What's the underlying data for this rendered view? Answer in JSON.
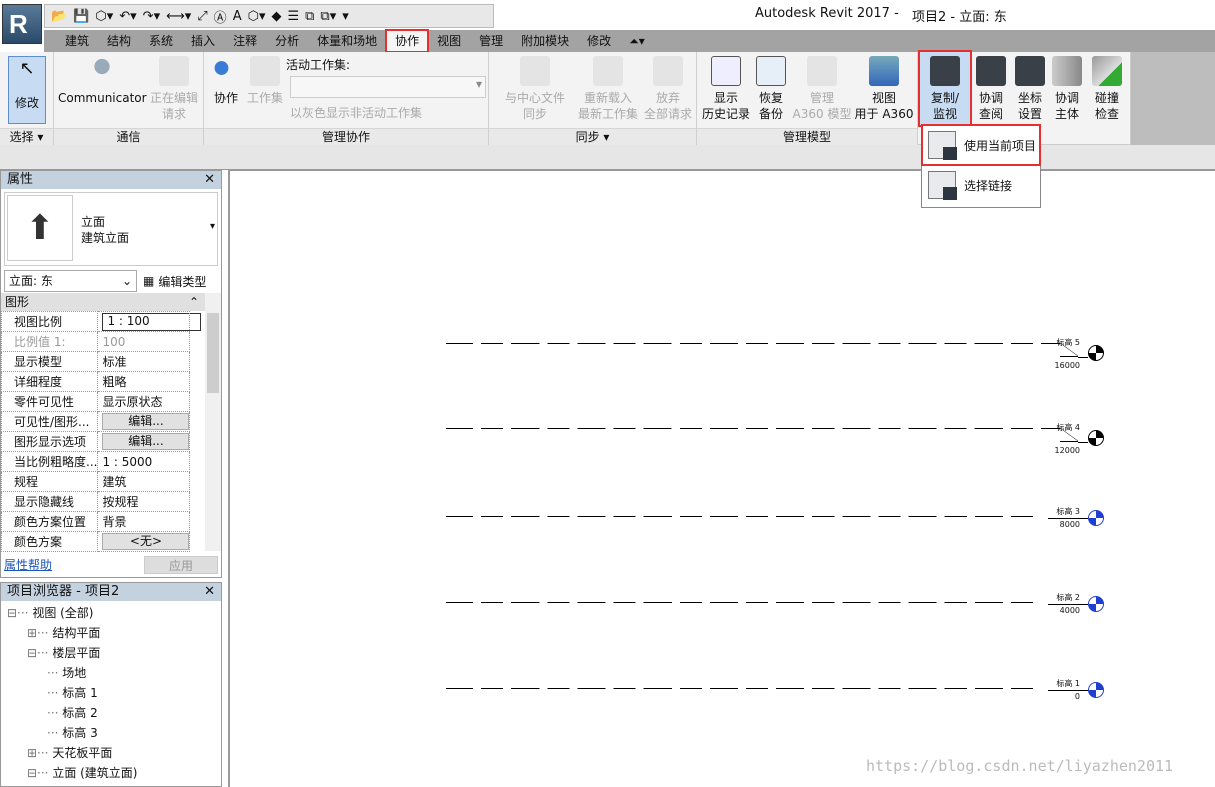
{
  "app": {
    "title": "Autodesk Revit 2017 -",
    "doc_title": "项目2 - 立面: 东",
    "logo": "R"
  },
  "qat": [
    "📂",
    "💾",
    "⬡▾",
    "↶▾",
    "↷▾",
    "⟷▾",
    "⤢",
    "Ⓐ",
    "A",
    "⬡▾",
    "◆",
    "☰",
    "⧉",
    "⧉▾",
    "▾"
  ],
  "tabs": [
    "建筑",
    "结构",
    "系统",
    "插入",
    "注释",
    "分析",
    "体量和场地",
    "协作",
    "视图",
    "管理",
    "附加模块",
    "修改",
    "⏶▾"
  ],
  "active_tab": "协作",
  "ribbon": {
    "select": {
      "button": "修改",
      "label": "选择 ▾"
    },
    "comm": {
      "b1": "Communicator",
      "b2a": "正在编辑",
      "b2b": "请求",
      "label": "通信"
    },
    "manage": {
      "b1": "协作",
      "b2": "工作集",
      "ws_label": "活动工作集:",
      "gray": "以灰色显示非活动工作集",
      "label": "管理协作"
    },
    "sync": {
      "b1a": "与中心文件",
      "b1b": "同步",
      "b2a": "重新载入",
      "b2b": "最新工作集",
      "b3a": "放弃",
      "b3b": "全部请求",
      "label": "同步 ▾"
    },
    "model": {
      "b1a": "显示",
      "b1b": "历史记录",
      "b2a": "恢复",
      "b2b": "备份",
      "b3a": "管理",
      "b3b": "A360 模型",
      "b4a": "视图",
      "b4b": "用于 A360",
      "label": "管理模型"
    },
    "coord": {
      "b1a": "复制/",
      "b1b": "监视",
      "b2a": "协调",
      "b2b": "查阅",
      "b3a": "坐标",
      "b3b": "设置",
      "b4a": "协调",
      "b4b": "主体",
      "b5a": "碰撞",
      "b5b": "检查"
    }
  },
  "dropdown": [
    "使用当前项目",
    "选择链接"
  ],
  "properties": {
    "title": "属性",
    "type1": "立面",
    "type2": "建筑立面",
    "selector": "立面: 东",
    "edit_type": "编辑类型",
    "group": "图形",
    "rows": [
      [
        "视图比例",
        "1 : 100"
      ],
      [
        "比例值 1:",
        "100"
      ],
      [
        "显示模型",
        "标准"
      ],
      [
        "详细程度",
        "粗略"
      ],
      [
        "零件可见性",
        "显示原状态"
      ],
      [
        "可见性/图形...",
        "编辑..."
      ],
      [
        "图形显示选项",
        "编辑..."
      ],
      [
        "当比例粗略度...",
        "1 : 5000"
      ],
      [
        "规程",
        "建筑"
      ],
      [
        "显示隐藏线",
        "按规程"
      ],
      [
        "颜色方案位置",
        "背景"
      ],
      [
        "颜色方案",
        "<无>"
      ]
    ],
    "help": "属性帮助",
    "apply": "应用"
  },
  "browser": {
    "title": "项目浏览器 - 项目2",
    "items": [
      "视图 (全部)",
      "结构平面",
      "楼层平面",
      "场地",
      "标高 1",
      "标高 2",
      "标高 3",
      "天花板平面",
      "立面 (建筑立面)"
    ]
  },
  "levels": [
    {
      "name": "标高 5",
      "elev": "16000",
      "color": "#000000"
    },
    {
      "name": "标高 4",
      "elev": "12000",
      "color": "#000000"
    },
    {
      "name": "标高 3",
      "elev": "8000",
      "color": "#1f3fd0"
    },
    {
      "name": "标高 2",
      "elev": "4000",
      "color": "#1f3fd0"
    },
    {
      "name": "标高 1",
      "elev": "0",
      "color": "#1f3fd0"
    }
  ],
  "watermark": "https://blog.csdn.net/liyazhen2011"
}
